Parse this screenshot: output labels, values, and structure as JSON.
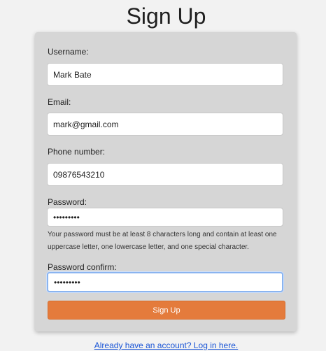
{
  "page": {
    "title": "Sign Up"
  },
  "form": {
    "username": {
      "label": "Username:",
      "value": "Mark Bate"
    },
    "email": {
      "label": "Email:",
      "value": "mark@gmail.com"
    },
    "phone": {
      "label": "Phone number:",
      "value": "09876543210"
    },
    "password": {
      "label": "Password:",
      "value": "123456789",
      "hint": "Your password must be at least 8 characters long and contain at least one uppercase letter, one lowercase letter, and one special character."
    },
    "password_confirm": {
      "label": "Password confirm:",
      "value": "123456789"
    },
    "submit_label": "Sign Up"
  },
  "footer": {
    "login_link": "Already have an account? Log in here."
  },
  "colors": {
    "background": "#f2f2f2",
    "card": "#d6d6d6",
    "button": "#e47b3c",
    "link": "#1a55d6",
    "focus_ring": "#8ab4f0"
  }
}
